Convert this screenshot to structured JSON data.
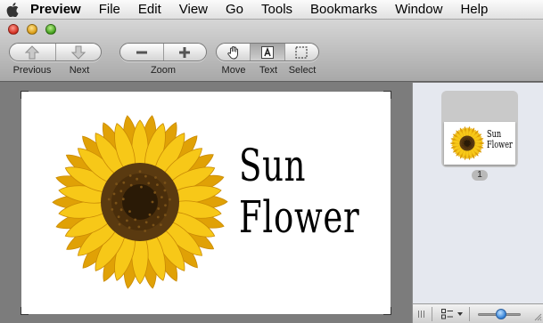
{
  "menubar": {
    "app_name": "Preview",
    "items": [
      "File",
      "Edit",
      "View",
      "Go",
      "Tools",
      "Bookmarks",
      "Window",
      "Help"
    ]
  },
  "toolbar": {
    "previous_label": "Previous",
    "next_label": "Next",
    "zoom_label": "Zoom",
    "move_label": "Move",
    "text_label": "Text",
    "select_label": "Select",
    "active_tool": "Text"
  },
  "document": {
    "line1": "Sun",
    "line2": "Flower",
    "image": "sunflower"
  },
  "sidebar": {
    "thumbnail_line1": "Sun",
    "thumbnail_line2": "Flower",
    "page_number": "1",
    "thumbnail_size": 0.55
  },
  "colors": {
    "petal": "#f7c818",
    "petal_dark": "#e0a106",
    "center": "#5a3a10",
    "center_dark": "#2a1a06",
    "selection_blue": "#2f7fd6"
  },
  "icons": {
    "apple": "apple-icon",
    "previous": "up-arrow-icon",
    "next": "down-arrow-icon",
    "zoom_out": "minus-icon",
    "zoom_in": "plus-icon",
    "move": "hand-icon",
    "text": "text-cursor-icon",
    "select": "marquee-icon"
  }
}
